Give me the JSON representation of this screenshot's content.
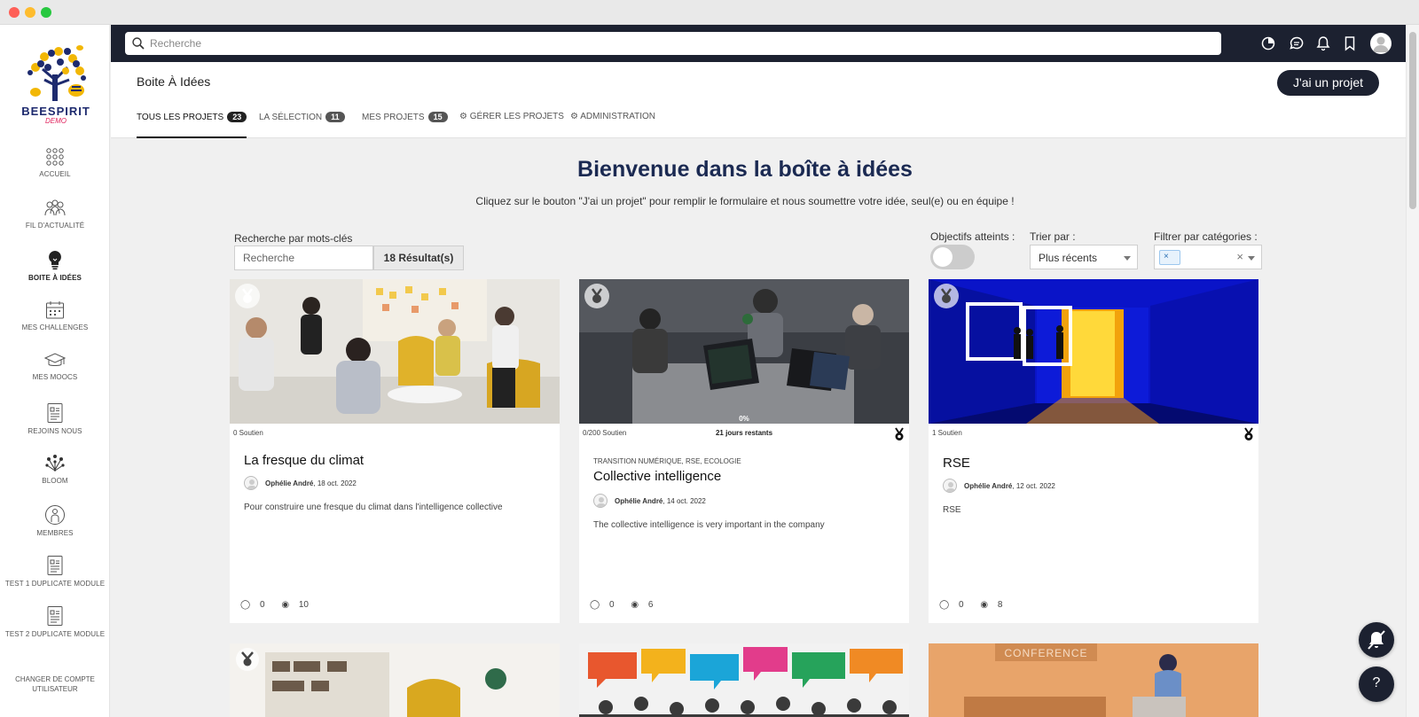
{
  "sidebar": {
    "logo_text": "BEESPIRIT",
    "logo_sub": "DEMO",
    "items": [
      {
        "label": "ACCUEIL",
        "icon": "grid-dots-icon"
      },
      {
        "label": "FIL D'ACTUALITÉ",
        "icon": "people-icon"
      },
      {
        "label": "BOITE À IDÉES",
        "icon": "lightbulb-icon"
      },
      {
        "label": "MES CHALLENGES",
        "icon": "calendar-icon"
      },
      {
        "label": "MES MOOCS",
        "icon": "graduation-cap-icon"
      },
      {
        "label": "REJOINS NOUS",
        "icon": "document-icon"
      },
      {
        "label": "BLOOM",
        "icon": "bloom-icon"
      },
      {
        "label": "MEMBRES",
        "icon": "member-icon"
      },
      {
        "label": "TEST 1 DUPLICATE MODULE",
        "icon": "document-icon"
      },
      {
        "label": "TEST 2 DUPLICATE MODULE",
        "icon": "document-icon"
      }
    ],
    "switch_account": "CHANGER DE COMPTE UTILISATEUR"
  },
  "topbar": {
    "search_placeholder": "Recherche"
  },
  "header": {
    "title": "Boite À Idées",
    "primary_button": "J'ai un projet",
    "tabs": [
      {
        "label": "TOUS LES PROJETS",
        "badge": "23",
        "active": true
      },
      {
        "label": "LA SÉLECTION",
        "badge": "11"
      },
      {
        "label": "MES PROJETS",
        "badge": "15"
      },
      {
        "label": "GÉRER LES PROJETS"
      },
      {
        "label": "ADMINISTRATION"
      }
    ]
  },
  "main": {
    "welcome_title": "Bienvenue dans la boîte à idées",
    "welcome_sub": "Cliquez sur le bouton \"J'ai un projet\" pour remplir le formulaire et nous soumettre votre idée, seul(e) ou en équipe !",
    "keyword_label": "Recherche par mots-clés",
    "keyword_placeholder": "Recherche",
    "results": "18 Résultat(s)",
    "objectives_label": "Objectifs atteints :",
    "sort_label": "Trier par :",
    "sort_value": "Plus récents",
    "category_label": "Filtrer par catégories :",
    "category_chip": "×",
    "category_clear": "×"
  },
  "cards": [
    {
      "soutien": "0 Soutien",
      "title": "La fresque du climat",
      "author": "Ophélie André",
      "date": ", 18 oct. 2022",
      "desc": "Pour construire une fresque du climat dans l'intelligence collective",
      "comments": "0",
      "views": "10"
    },
    {
      "soutien": "0/200 Soutien",
      "progress_label": "0%",
      "remaining": "21 jours restants",
      "categories": "TRANSITION NUMÉRIQUE, RSE, ECOLOGIE",
      "title": "Collective intelligence",
      "author": "Ophélie André",
      "date": ", 14 oct. 2022",
      "desc": "The collective intelligence is very important in the company",
      "comments": "0",
      "views": "6"
    },
    {
      "soutien": "1 Soutien",
      "title": "RSE",
      "author": "Ophélie André",
      "date": ", 12 oct. 2022",
      "desc": "RSE",
      "comments": "0",
      "views": "8"
    }
  ],
  "card_row2_banner": "CONFERENCE",
  "help_label": "?",
  "colors": {
    "dark": "#1c2130",
    "title": "#1b2a52"
  }
}
